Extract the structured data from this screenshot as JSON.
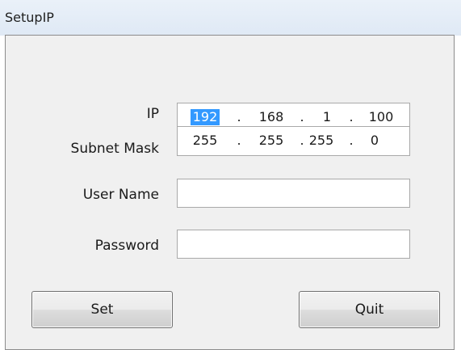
{
  "window": {
    "title": "SetupIP"
  },
  "form": {
    "ip": {
      "label": "IP",
      "octets": [
        "192",
        "168",
        "1",
        "100"
      ],
      "selected_octet": 0
    },
    "subnet": {
      "label": "Subnet Mask",
      "octets": [
        "255",
        "255",
        "255",
        "0"
      ]
    },
    "username": {
      "label": "User Name",
      "value": ""
    },
    "password": {
      "label": "Password",
      "value": ""
    }
  },
  "buttons": {
    "set_label": "Set",
    "quit_label": "Quit"
  },
  "colors": {
    "selection": "#3399ff",
    "titlebar": "#dfe9f5",
    "background": "#f0f0f0"
  }
}
